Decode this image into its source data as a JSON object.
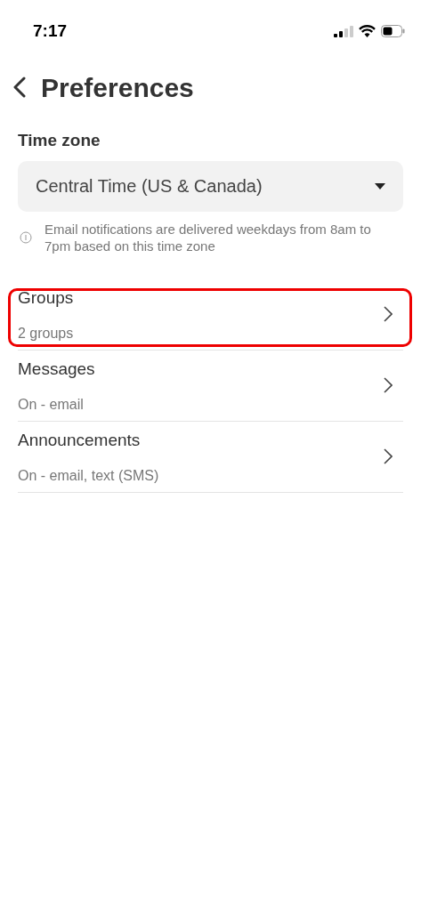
{
  "status_bar": {
    "time": "7:17"
  },
  "header": {
    "title": "Preferences"
  },
  "time_zone": {
    "label": "Time zone",
    "value": "Central Time (US & Canada)",
    "note": "Email notifications are delivered weekdays from 8am to 7pm based on this time zone"
  },
  "settings": [
    {
      "title": "Groups",
      "subtitle": "2 groups",
      "highlighted": true
    },
    {
      "title": "Messages",
      "subtitle": "On - email",
      "highlighted": false
    },
    {
      "title": "Announcements",
      "subtitle": "On - email, text (SMS)",
      "highlighted": false
    }
  ]
}
